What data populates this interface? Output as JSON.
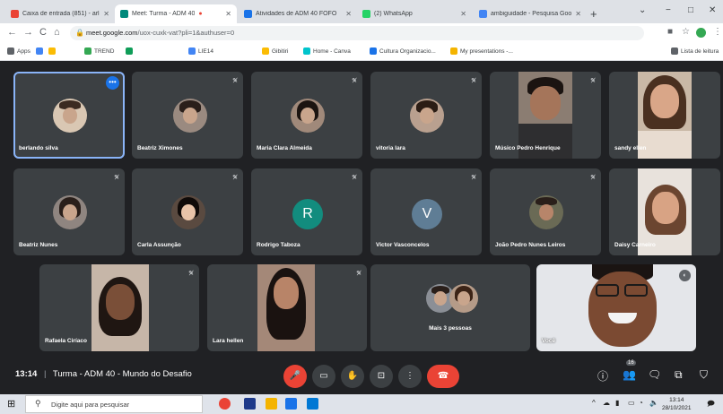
{
  "browser": {
    "tabs": [
      {
        "label": "Caixa de entrada (851) - arlc",
        "favicon_color": "#ea4335",
        "active": false
      },
      {
        "label": "Meet: Turma - ADM 40",
        "favicon_color": "#00897b",
        "active": true
      },
      {
        "label": "Atividades de ADM 40 FOFO",
        "favicon_color": "#1a73e8",
        "active": false
      },
      {
        "label": "(2) WhatsApp",
        "favicon_color": "#25d366",
        "active": false
      },
      {
        "label": "ambiguidade - Pesquisa Goo",
        "favicon_color": "#4285f4",
        "active": false
      }
    ],
    "new_tab": "+",
    "window_controls": {
      "minimize": "−",
      "maximize": "□",
      "close": "✕"
    },
    "nav": {
      "back": "←",
      "forward": "→",
      "reload": "C",
      "home": "⌂"
    },
    "url": {
      "host": "meet.google.com",
      "path": "/uox-cuxk-vat?pli=1&authuser=0"
    },
    "bookmarks": [
      {
        "label": "Apps",
        "color": "#5f6368"
      },
      {
        "label": "",
        "color": "#4285f4"
      },
      {
        "label": "",
        "color": "#fbbc04"
      },
      {
        "label": "TREND",
        "color": "#34a853"
      },
      {
        "label": "",
        "color": "#0f9d58"
      },
      {
        "label": "LIE14",
        "color": "#4285f4"
      },
      {
        "label": "Gibitiri",
        "color": "#fbbc04"
      },
      {
        "label": "Home - Canva",
        "color": "#00c4cc"
      },
      {
        "label": "Cultura Organizacio...",
        "color": "#1a73e8"
      },
      {
        "label": "My presentations -...",
        "color": "#f4b400"
      }
    ],
    "reading_list": "Lista de leitura"
  },
  "meet": {
    "participants": [
      {
        "name": "berlando silva",
        "kind": "avatar",
        "muted": false,
        "selected": true
      },
      {
        "name": "Beatriz Ximones",
        "kind": "avatar",
        "muted": true
      },
      {
        "name": "Maria Clara Almeida",
        "kind": "avatar",
        "muted": true
      },
      {
        "name": "vitoria lara",
        "kind": "avatar",
        "muted": true
      },
      {
        "name": "Músico Pedro Henrique",
        "kind": "video",
        "muted": true
      },
      {
        "name": "sandy ellen",
        "kind": "video",
        "muted": false
      },
      {
        "name": "Beatriz Nunes",
        "kind": "avatar",
        "muted": true
      },
      {
        "name": "Carla Assunção",
        "kind": "avatar",
        "muted": true
      },
      {
        "name": "Rodrigo Taboza",
        "kind": "letter",
        "letter": "R",
        "letter_color": "#128c7e",
        "muted": true
      },
      {
        "name": "Victor Vasconcelos",
        "kind": "letter",
        "letter": "V",
        "letter_color": "#5f7d95",
        "muted": true
      },
      {
        "name": "João Pedro Nunes Leiros",
        "kind": "avatar",
        "muted": true
      },
      {
        "name": "Daisy Carneiro",
        "kind": "video",
        "muted": false
      },
      {
        "name": "Rafaela Ciríaco",
        "kind": "video",
        "muted": true
      },
      {
        "name": "Lara hellen",
        "kind": "video",
        "muted": true
      },
      {
        "name": "Mais 3 pessoas",
        "kind": "group",
        "muted": false
      },
      {
        "name": "Você",
        "kind": "video",
        "muted": false
      }
    ],
    "more_options": "•••",
    "meeting_time": "13:14",
    "meeting_name": "Turma - ADM 40 - Mundo do Desafio",
    "separator": "|",
    "controls": {
      "mic_icon": "mic-off",
      "camera_icon": "camera",
      "hand_icon": "raise-hand",
      "present_icon": "present-screen",
      "more_icon": "more-vert",
      "hangup_icon": "call-end"
    },
    "right_controls": [
      "info-icon",
      "people-icon",
      "chat-icon",
      "activities-icon",
      "host-controls-icon"
    ],
    "people_count": "16",
    "accent": "#ea4335"
  },
  "taskbar": {
    "search_placeholder": "Digite aqui para pesquisar",
    "clock_time": "13:14",
    "clock_date": "28/10/2021"
  }
}
